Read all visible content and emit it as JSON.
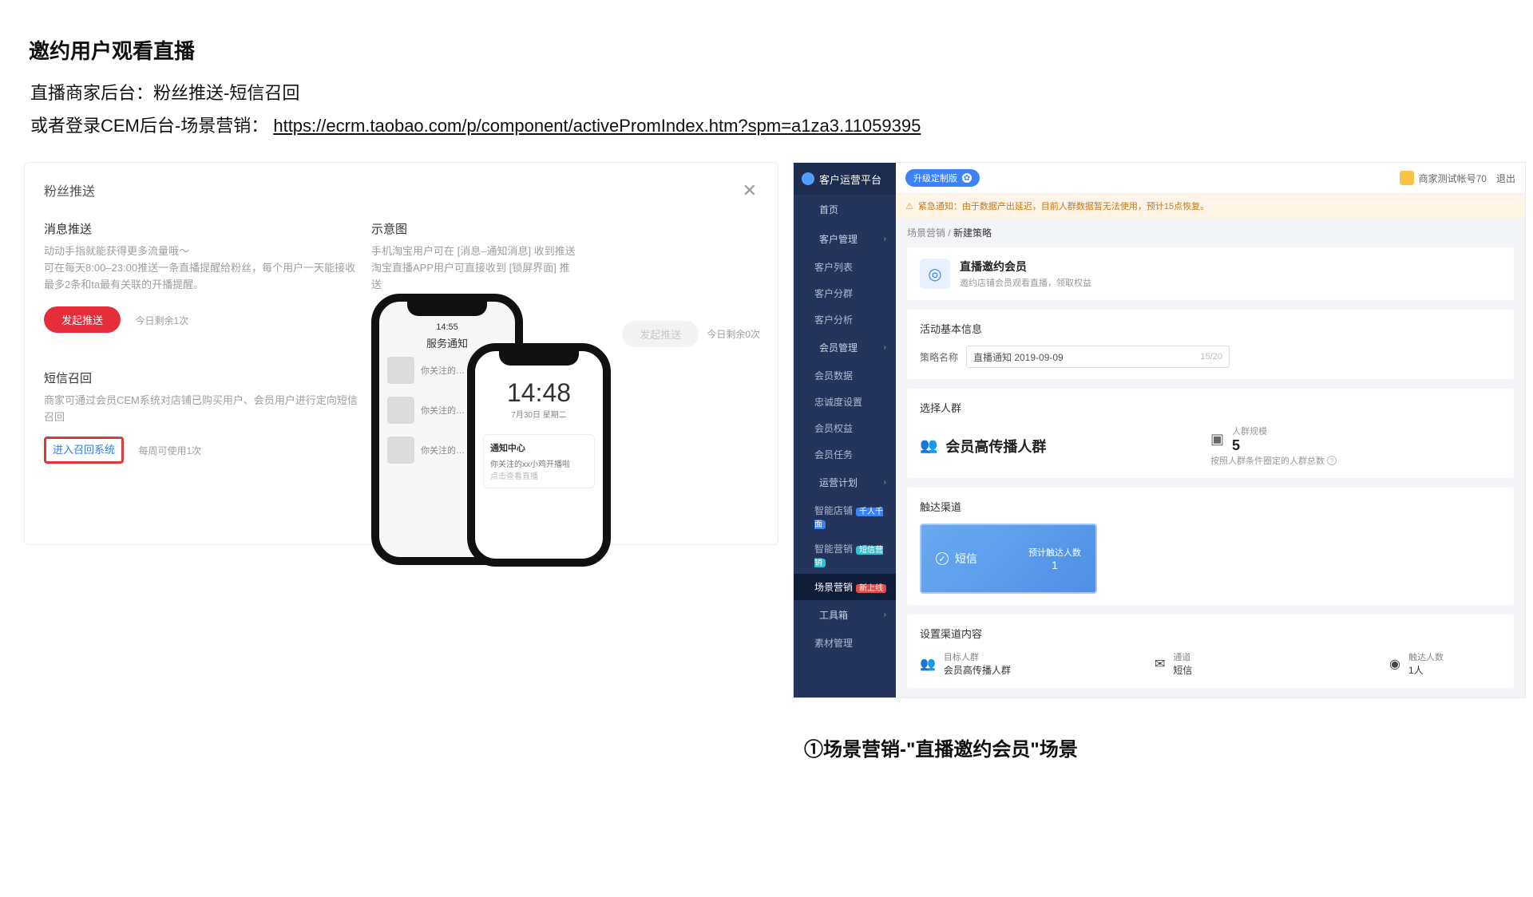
{
  "slide": {
    "title": "邀约用户观看直播",
    "line1": "直播商家后台：粉丝推送-短信召回",
    "line2_prefix": "或者登录CEM后台-场景营销：",
    "line2_link": "https://ecrm.taobao.com/p/component/activePromIndex.htm?spm=a1za3.11059395",
    "captionB": "①场景营销-\"直播邀约会员\"场景"
  },
  "dlg": {
    "title": "粉丝推送",
    "push_h": "消息推送",
    "push_sub": "动动手指就能获得更多流量哦～",
    "push_p": "可在每天8:00–23:00推送一条直播提醒给粉丝，每个用户一天能接收最多2条和ta最有关联的开播提醒。",
    "push_btn": "发起推送",
    "push_hint": "今日剩余1次",
    "disabled_btn": "发起推送",
    "disabled_hint": "今日剩余0次",
    "sms_h": "短信召回",
    "sms_p": "商家可通过会员CEM系统对店铺已购买用户、会员用户进行定向短信召回",
    "sms_link": "进入召回系统",
    "sms_hint": "每周可使用1次",
    "sample_h": "示意图",
    "sample_p": "手机淘宝用户可在 [消息–通知消息] 收到推送淘宝直播APP用户可直接收到 [锁屏界面] 推送",
    "phone1_bar": "14:55",
    "phone1_svc": "服务通知",
    "phone1_item": "你关注的…",
    "phone2_clock": "14:48",
    "phone2_date": "7月30日 星期二",
    "phone2_card_h": "通知中心",
    "phone2_card_t": "你关注的xx小鸡开播啦",
    "phone2_card_s": "点击查看直播"
  },
  "crm": {
    "brand": "客户运营平台",
    "topbar_pill": "升级定制版",
    "acct": "商家测试帐号70",
    "logout": "退出",
    "alert": "紧急通知：由于数据产出延迟，目前人群数据暂无法使用，预计15点恢复。",
    "crumb1": "场景营销",
    "crumb2": "新建策略",
    "nav": [
      {
        "label": "首页",
        "type": "head"
      },
      {
        "label": "客户管理",
        "type": "head",
        "chev": true
      },
      {
        "label": "客户列表",
        "type": "sub"
      },
      {
        "label": "客户分群",
        "type": "sub"
      },
      {
        "label": "客户分析",
        "type": "sub"
      },
      {
        "label": "会员管理",
        "type": "head",
        "chev": true
      },
      {
        "label": "会员数据",
        "type": "sub"
      },
      {
        "label": "忠诚度设置",
        "type": "sub"
      },
      {
        "label": "会员权益",
        "type": "sub"
      },
      {
        "label": "会员任务",
        "type": "sub"
      },
      {
        "label": "运营计划",
        "type": "head",
        "chev": true
      },
      {
        "label": "智能店铺",
        "type": "sub",
        "tag": "千人千面",
        "tagClass": "tag-blue"
      },
      {
        "label": "智能营销",
        "type": "sub",
        "tag": "短信营销",
        "tagClass": "tag-teal"
      },
      {
        "label": "场景营销",
        "type": "sub",
        "sel": true,
        "tag": "新上线",
        "tagClass": "tag-red"
      },
      {
        "label": "工具箱",
        "type": "head",
        "chev": true
      },
      {
        "label": "素材管理",
        "type": "sub"
      }
    ],
    "hero_h": "直播邀约会员",
    "hero_p": "邀约店铺会员观看直播，领取权益",
    "basic_h": "活动基本信息",
    "name_label": "策略名称",
    "name_value": "直播通知 2019-09-09",
    "name_count": "15/20",
    "sel_h": "选择人群",
    "group_name": "会员高传播人群",
    "scale_label": "人群规模",
    "scale_value": "5",
    "scale_note": "按照人群条件圈定的人群总数",
    "chan_h": "触达渠道",
    "sms_label": "短信",
    "sms_est_label": "预计触达人数",
    "sms_est_value": "1",
    "set_h": "设置渠道内容",
    "col_target_l": "目标人群",
    "col_target_v": "会员高传播人群",
    "col_chan_l": "通道",
    "col_chan_v": "短信",
    "col_reach_l": "触达人数",
    "col_reach_v": "1人"
  }
}
